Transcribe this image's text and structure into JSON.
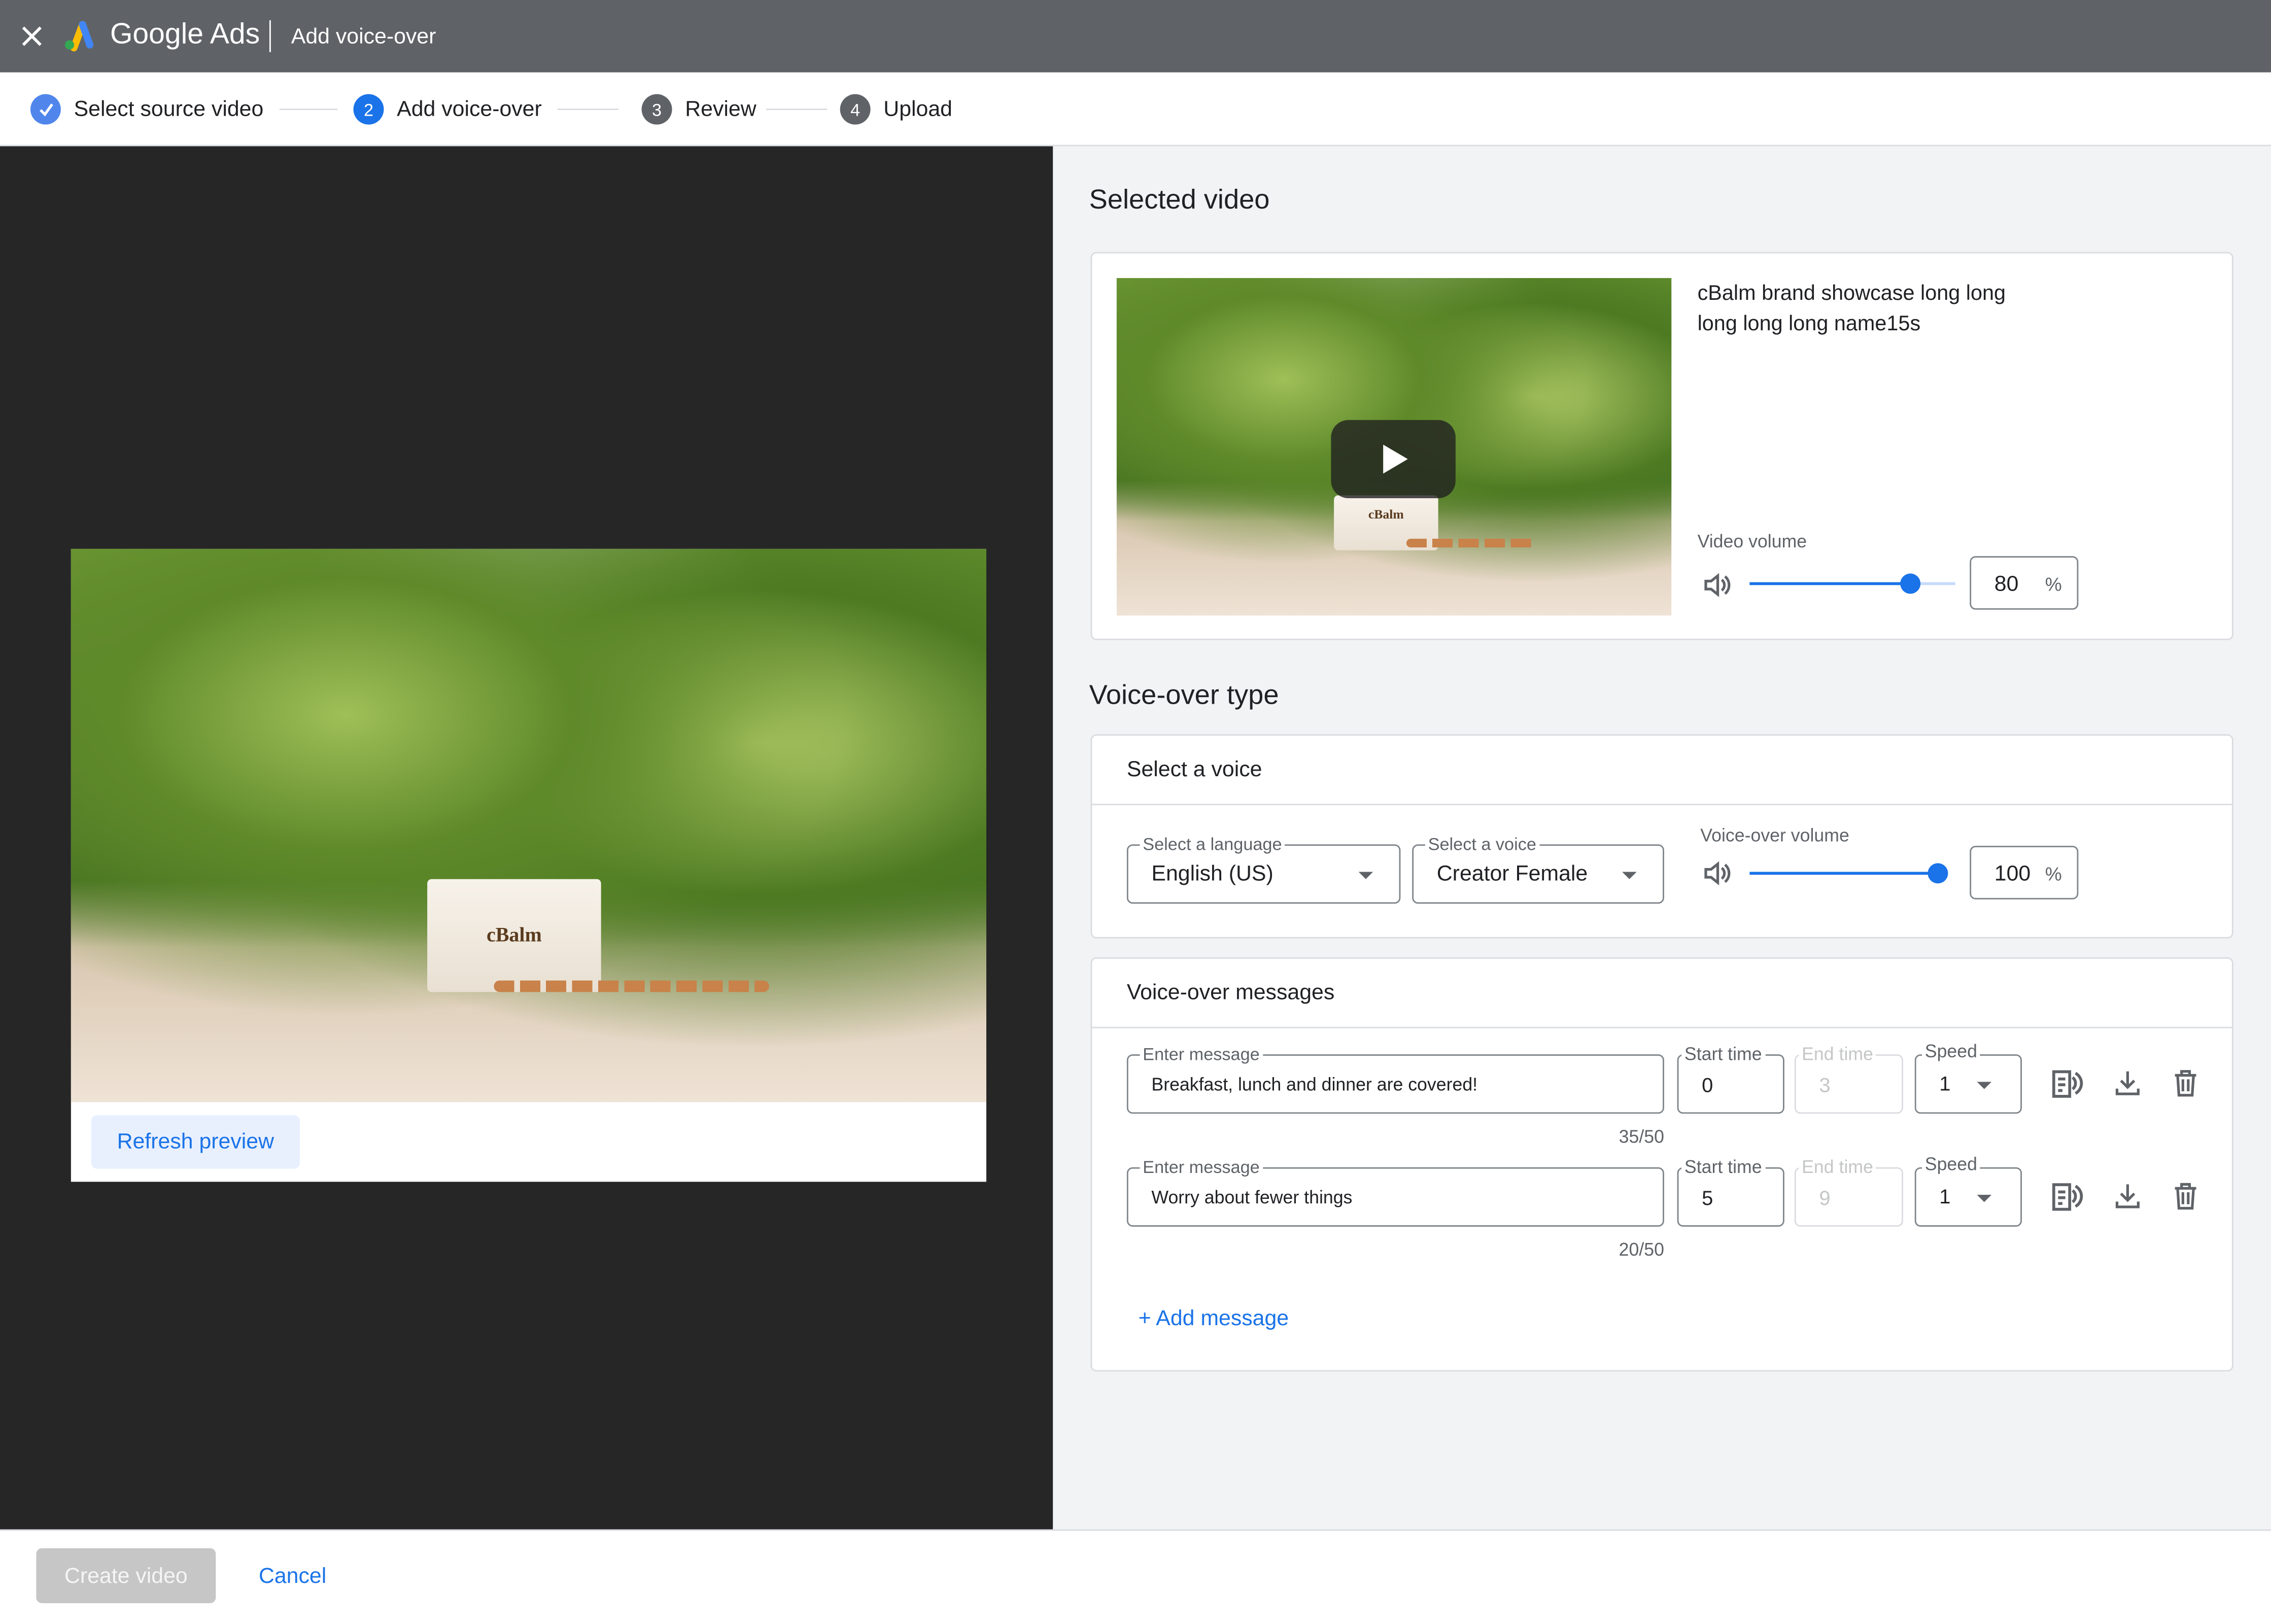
{
  "header": {
    "close_icon": "close-icon",
    "app_name": "Google Ads",
    "page_title": "Add voice-over"
  },
  "stepper": {
    "steps": [
      {
        "label": "Select source video",
        "state": "done"
      },
      {
        "label": "Add voice-over",
        "number": "2",
        "state": "active"
      },
      {
        "label": "Review",
        "number": "3",
        "state": "pending"
      },
      {
        "label": "Upload",
        "number": "4",
        "state": "pending"
      }
    ]
  },
  "preview": {
    "refresh_label": "Refresh preview",
    "brand_text": "cBalm"
  },
  "selected_video": {
    "heading": "Selected video",
    "title": "cBalm brand showcase long long long long long name15s",
    "volume_label": "Video volume",
    "volume": "80",
    "volume_unit": "%"
  },
  "voice_type": {
    "heading": "Voice-over type",
    "card_title": "Select a voice",
    "language": {
      "label": "Select a language",
      "value": "English (US)"
    },
    "voice": {
      "label": "Select a voice",
      "value": "Creator Female"
    },
    "volume_label": "Voice-over volume",
    "volume": "100",
    "volume_unit": "%"
  },
  "messages": {
    "heading": "Voice-over messages",
    "add_label": "+ Add message",
    "items": [
      {
        "message_label": "Enter message",
        "message": "Breakfast, lunch and dinner are covered!",
        "start_label": "Start time",
        "start": "0",
        "end_label": "End time",
        "end": "3",
        "speed_label": "Speed",
        "speed": "1",
        "counter": "35/50"
      },
      {
        "message_label": "Enter message",
        "message": "Worry about fewer things",
        "start_label": "Start time",
        "start": "5",
        "end_label": "End time",
        "end": "9",
        "speed_label": "Speed",
        "speed": "1",
        "counter": "20/50"
      }
    ]
  },
  "footer": {
    "create_label": "Create video",
    "cancel_label": "Cancel"
  },
  "colors": {
    "accent": "#1a73e8",
    "header_bg": "#5f6368",
    "preview_bg": "#262626"
  }
}
